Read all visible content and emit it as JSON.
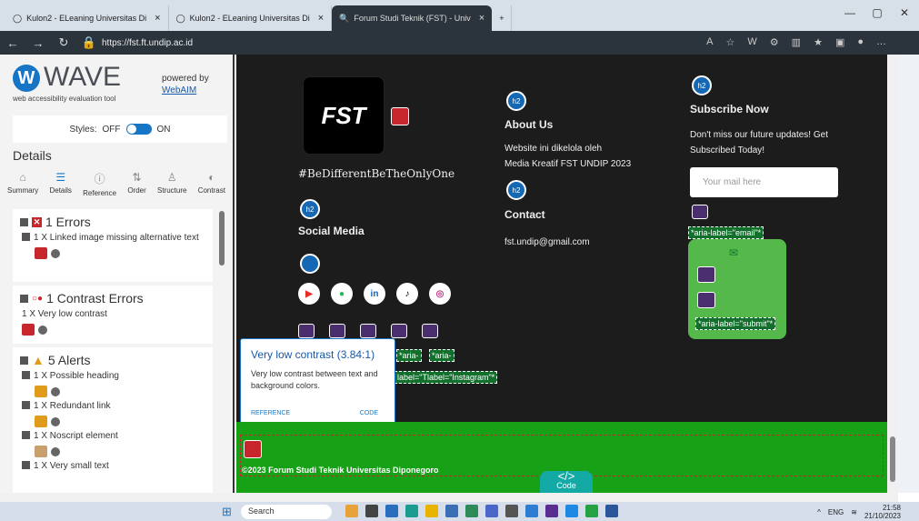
{
  "browser": {
    "tabs": [
      {
        "label": "Kulon2 - ELeaning Universitas Di",
        "active": false
      },
      {
        "label": "Kulon2 - ELeaning Universitas Di",
        "active": false
      },
      {
        "label": "Forum Studi Teknik (FST) - Univ",
        "active": true
      }
    ],
    "url": "https://fst.ft.undip.ac.id"
  },
  "wave": {
    "logo": "WAVE",
    "powered_by": "powered by",
    "webaim": "WebAIM",
    "tagline": "web accessibility evaluation tool",
    "styles_label": "Styles:",
    "off": "OFF",
    "on": "ON",
    "details_heading": "Details",
    "tabs": [
      "Summary",
      "Details",
      "Reference",
      "Order",
      "Structure",
      "Contrast"
    ],
    "errors_title": "1 Errors",
    "error_item": "1 X Linked image missing alternative text",
    "contrast_title": "1 Contrast Errors",
    "contrast_item": "1 X Very low contrast",
    "alerts_title": "5 Alerts",
    "alert_items": [
      "1 X Possible heading",
      "1 X Redundant link",
      "1 X Noscript element",
      "1 X Very small text"
    ]
  },
  "site": {
    "logo_text": "FST",
    "hashtag": "#BeDifferentBeTheOnlyOne",
    "social_heading": "Social Media",
    "about_heading": "About Us",
    "about_text1": "Website ini dikelola oleh",
    "about_text2": "Media Kreatif FST UNDIP 2023",
    "contact_heading": "Contact",
    "contact_email": "fst.undip@gmail.com",
    "subscribe_heading": "Subscribe Now",
    "subscribe_text1": "Don't miss our future updates! Get",
    "subscribe_text2": "Subscribed Today!",
    "email_placeholder": "Your mail here",
    "aria_email": "*aria-label=\"email\"*",
    "aria_submit": "*aria-label=\"submit\"*",
    "aria_short1": "*aria-",
    "aria_short2": "*aria-",
    "aria_instagram": "label=\"Tlabel=\"Instagram\"*",
    "h2": "h2",
    "copyright": "©2023 Forum Studi Teknik Universitas Diponegoro",
    "code_label": "Code",
    "code_symbol": "</>"
  },
  "tooltip": {
    "title": "Very low contrast (3.84:1)",
    "desc": "Very low contrast between text and background colors.",
    "reference": "REFERENCE",
    "code": "CODE"
  },
  "taskbar": {
    "search": "Search",
    "lang": "ENG",
    "time": "21:58",
    "date": "21/10/2023"
  }
}
